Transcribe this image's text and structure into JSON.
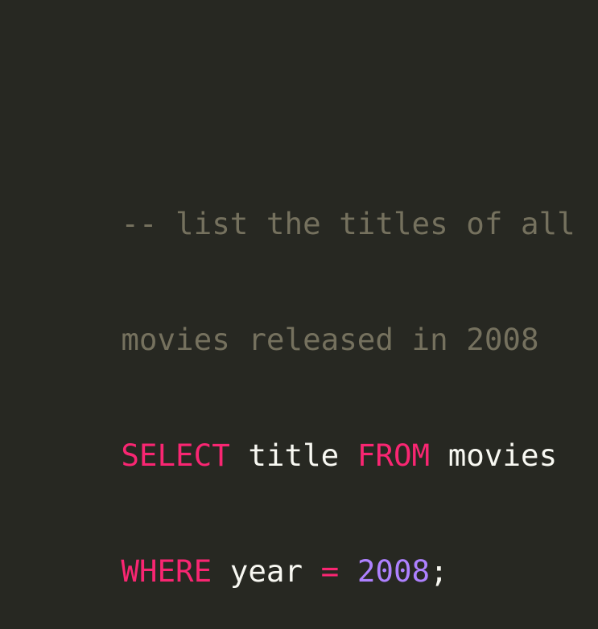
{
  "editor": {
    "background": "#272822",
    "colors": {
      "comment": "#75715e",
      "keyword": "#f92672",
      "text": "#f8f8f2",
      "number": "#ae81ff"
    },
    "lines": [
      {
        "tokens": [
          {
            "type": "comment",
            "text": "-- list the titles of all"
          }
        ]
      },
      {
        "tokens": [
          {
            "type": "comment",
            "text": "movies released in 2008"
          }
        ]
      },
      {
        "tokens": [
          {
            "type": "keyword",
            "text": "SELECT"
          },
          {
            "type": "space",
            "text": " "
          },
          {
            "type": "ident",
            "text": "title"
          },
          {
            "type": "space",
            "text": " "
          },
          {
            "type": "keyword",
            "text": "FROM"
          },
          {
            "type": "space",
            "text": " "
          },
          {
            "type": "ident",
            "text": "movies"
          }
        ]
      },
      {
        "tokens": [
          {
            "type": "keyword",
            "text": "WHERE"
          },
          {
            "type": "space",
            "text": " "
          },
          {
            "type": "ident",
            "text": "year"
          },
          {
            "type": "space",
            "text": " "
          },
          {
            "type": "op",
            "text": "="
          },
          {
            "type": "space",
            "text": " "
          },
          {
            "type": "number",
            "text": "2008"
          },
          {
            "type": "punct",
            "text": ";"
          }
        ]
      }
    ]
  }
}
